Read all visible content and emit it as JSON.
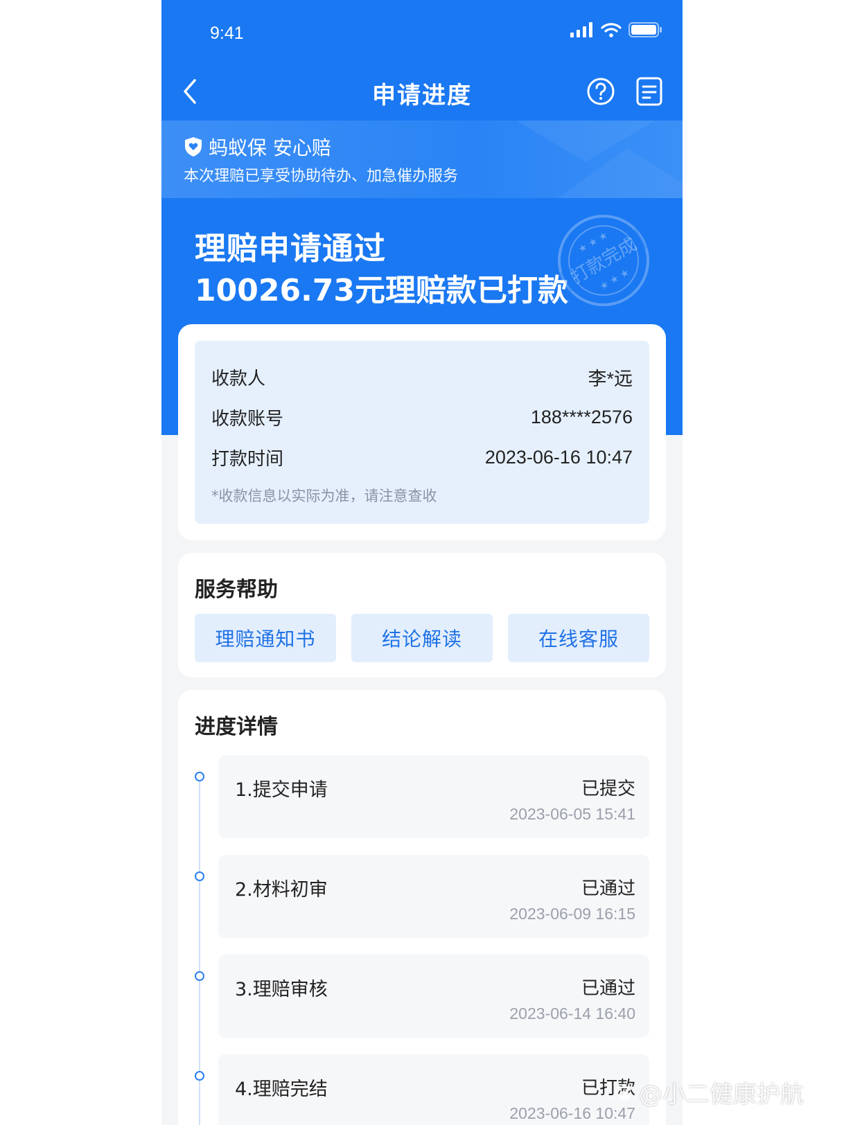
{
  "status_bar": {
    "time": "9:41"
  },
  "navbar": {
    "title": "申请进度",
    "back_icon": "chevron-left-icon",
    "help_icon": "question-circle-icon",
    "list_icon": "document-list-icon"
  },
  "banner": {
    "brand": "蚂蚁保 安心赔",
    "subtitle": "本次理赔已享受协助待办、加急催办服务",
    "brand_icon": "shield-heart-icon"
  },
  "hero": {
    "title": "理赔申请通过",
    "amount_text": "10026.73元理赔款已打款",
    "stamp_text": "打款完成"
  },
  "payment": {
    "rows": [
      {
        "label": "收款人",
        "value": "李*远"
      },
      {
        "label": "收款账号",
        "value": "188****2576"
      },
      {
        "label": "打款时间",
        "value": "2023-06-16 10:47"
      }
    ],
    "note": "*收款信息以实际为准，请注意查收"
  },
  "service": {
    "title": "服务帮助",
    "buttons": [
      "理赔通知书",
      "结论解读",
      "在线客服"
    ]
  },
  "progress": {
    "title": "进度详情",
    "steps": [
      {
        "name": "1.提交申请",
        "status": "已提交",
        "time": "2023-06-05 15:41"
      },
      {
        "name": "2.材料初审",
        "status": "已通过",
        "time": "2023-06-09 16:15"
      },
      {
        "name": "3.理赔审核",
        "status": "已通过",
        "time": "2023-06-14 16:40"
      },
      {
        "name": "4.理赔完结",
        "status": "已打款",
        "time": "2023-06-16 10:47"
      }
    ]
  },
  "watermark": {
    "text": "@小二健康护航"
  },
  "colors": {
    "primary": "#1a78f2",
    "light_blue": "#e6f0fd",
    "button_text": "#1f72e6"
  }
}
